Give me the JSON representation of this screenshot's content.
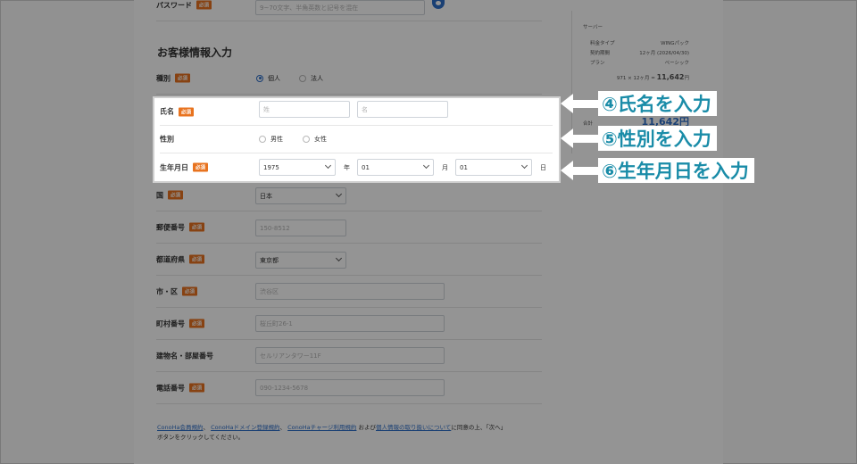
{
  "password": {
    "label": "パスワード",
    "required": "必須",
    "placeholder": "9~70文字、半角英数と記号を混在"
  },
  "section_title": "お客様情報入力",
  "type_row": {
    "label": "種別",
    "required": "必須",
    "options": [
      "個人",
      "法人"
    ]
  },
  "name_row": {
    "label": "氏名",
    "required": "必須",
    "last_placeholder": "姓",
    "first_placeholder": "名"
  },
  "gender_row": {
    "label": "性別",
    "options": [
      "男性",
      "女性"
    ]
  },
  "birth_row": {
    "label": "生年月日",
    "required": "必須",
    "year": "1975",
    "year_unit": "年",
    "month": "01",
    "month_unit": "月",
    "day": "01",
    "day_unit": "日"
  },
  "country_row": {
    "label": "国",
    "required": "必須",
    "value": "日本"
  },
  "postal_row": {
    "label": "郵便番号",
    "required": "必須",
    "placeholder": "150-8512"
  },
  "pref_row": {
    "label": "都道府県",
    "required": "必須",
    "value": "東京都"
  },
  "city_row": {
    "label": "市・区",
    "required": "必須",
    "placeholder": "渋谷区"
  },
  "town_row": {
    "label": "町村番号",
    "required": "必須",
    "placeholder": "桜丘町26-1"
  },
  "building_row": {
    "label": "建物名・部屋番号",
    "placeholder": "セルリアンタワー11F"
  },
  "phone_row": {
    "label": "電話番号",
    "required": "必須",
    "placeholder": "090-1234-5678"
  },
  "sidebar": {
    "heading": "サーバー",
    "rows": [
      {
        "key": "料金タイプ",
        "value": "WINGパック"
      },
      {
        "key": "契約期間",
        "value": "12ヶ月 (2026/04/30)"
      },
      {
        "key": "プラン",
        "value": "ベーシック"
      }
    ],
    "calc": "971 × 12ヶ月 = ",
    "calc_total": "11,642",
    "calc_unit": "円",
    "total_label": "合計",
    "total_value": "11,642円"
  },
  "callouts": [
    "④氏名を入力",
    "⑤性別を入力",
    "⑥生年月日を入力"
  ],
  "footer": {
    "link1": "ConoHa会員規約",
    "sep1": "、",
    "link2": "ConoHaドメイン登録規約",
    "sep2": "、",
    "link3": "ConoHaチャージ利用規約",
    "and": "および",
    "link4": "個人情報の取り扱いについて",
    "tail": "に同意の上、「次へ」",
    "line2": "ボタンをクリックしてください。"
  },
  "colors": {
    "accent": "#1a8ca8",
    "required_badge": "#e8731f",
    "link": "#2e6ec8"
  }
}
